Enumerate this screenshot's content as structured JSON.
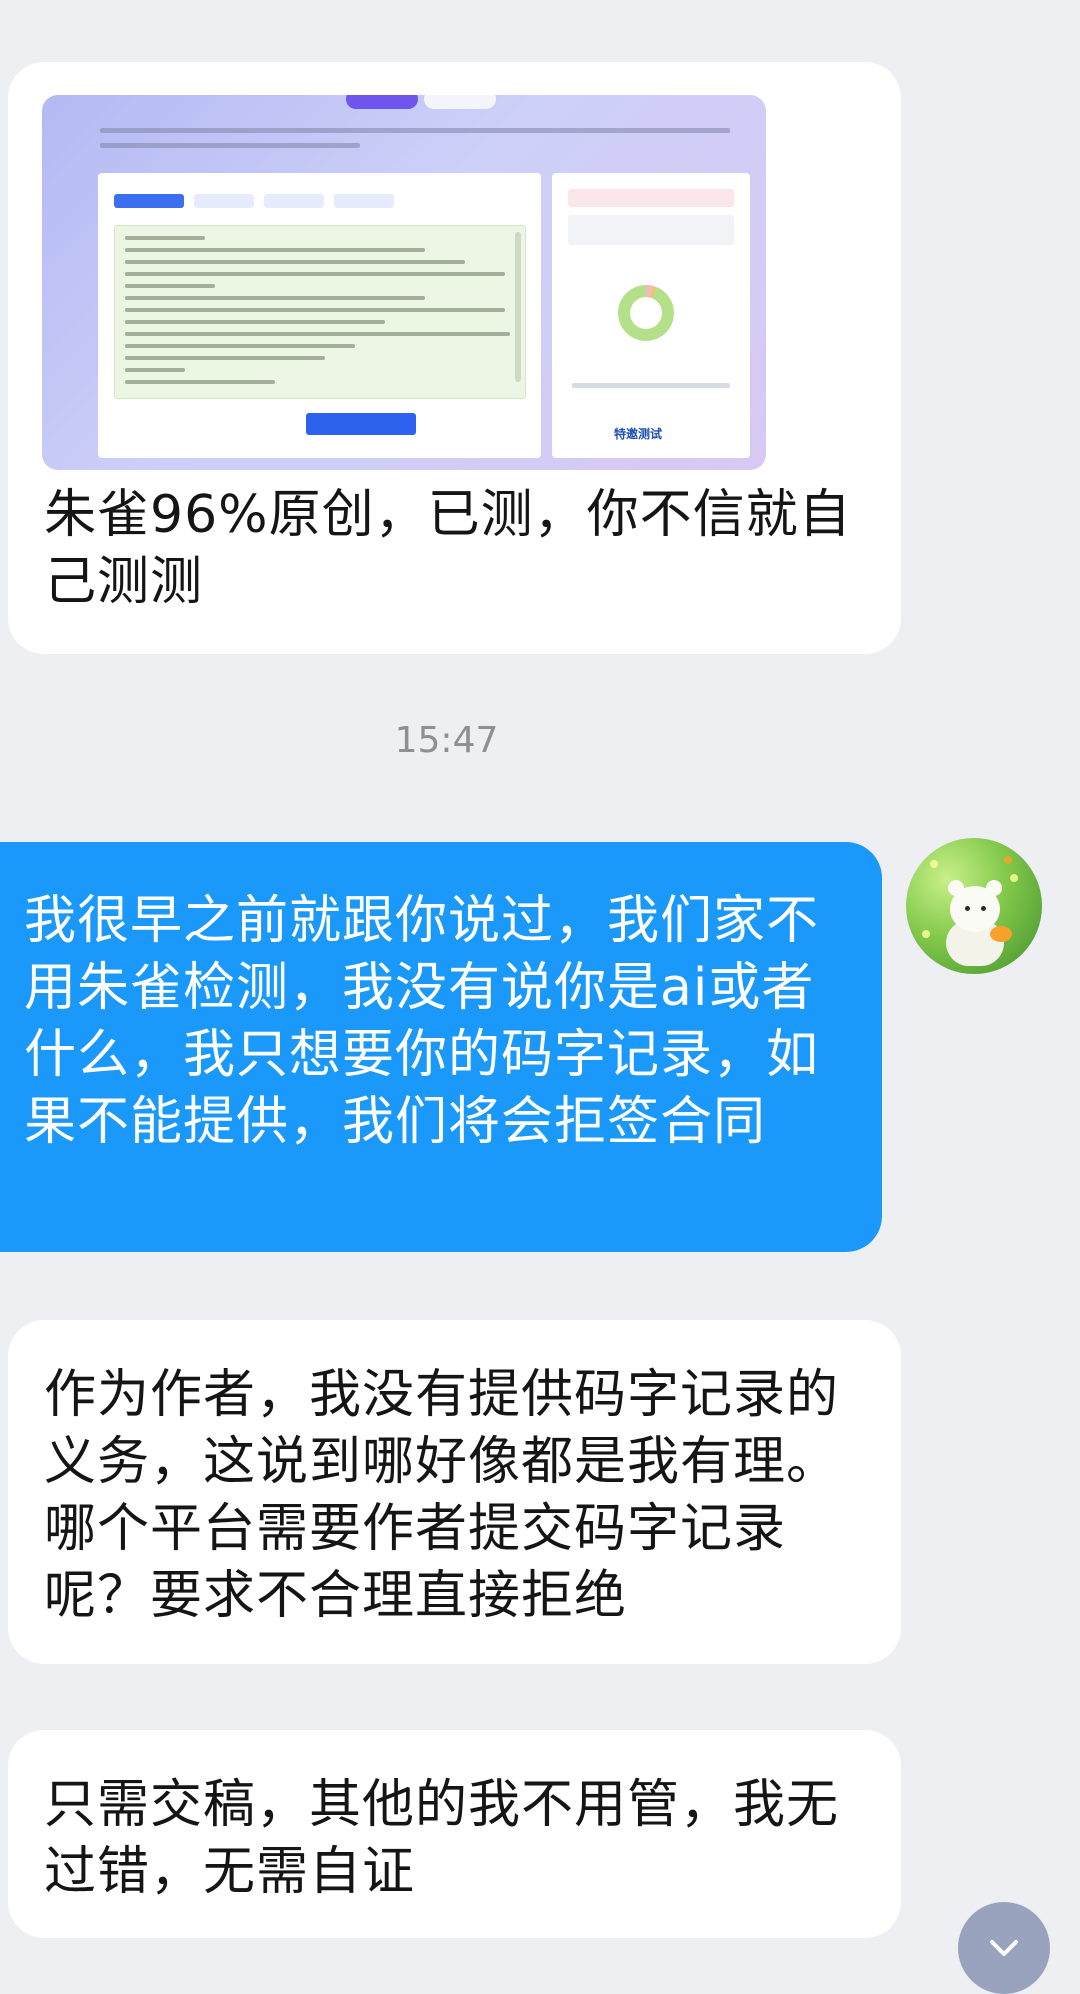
{
  "timestamp": "15:47",
  "messages": [
    {
      "side": "left",
      "has_image": true,
      "image_brand": "特邀测试",
      "text": "朱雀96%原创，已测，你不信就自己测测"
    },
    {
      "side": "right",
      "text": "我很早之前就跟你说过，我们家不用朱雀检测，我没有说你是ai或者什么，我只想要你的码字记录，如果不能提供，我们将会拒签合同"
    },
    {
      "side": "left",
      "text": "作为作者，我没有提供码字记录的义务，这说到哪好像都是我有理。哪个平台需要作者提交码字记录呢？要求不合理直接拒绝"
    },
    {
      "side": "left",
      "text": "只需交稿，其他的我不用管，我无过错，无需自证"
    }
  ],
  "colors": {
    "background": "#eeeff3",
    "incoming_bubble": "#ffffff",
    "outgoing_bubble": "#1a99fb",
    "scroll_button": "#9aa3bd"
  },
  "icons": {
    "scroll_button": "chevron-down-icon",
    "avatar": "bear-avatar"
  }
}
